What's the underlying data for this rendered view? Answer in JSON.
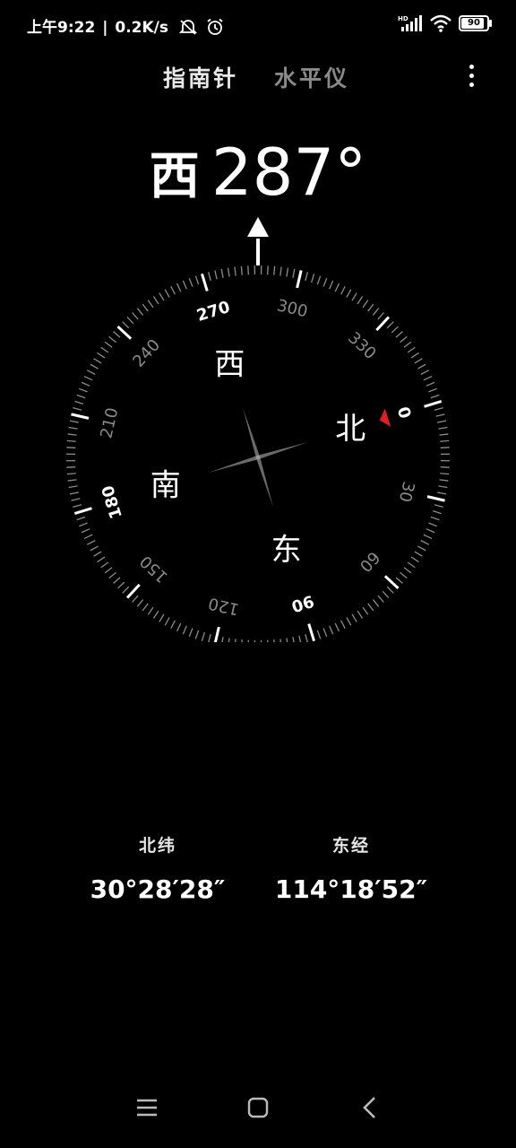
{
  "status_bar": {
    "time": "上午9:22",
    "network_speed": "0.2K/s",
    "muted_icon": "bell-off-icon",
    "alarm_icon": "alarm-icon",
    "hd_label": "HD",
    "battery": "90"
  },
  "tabs": [
    {
      "label": "指南针",
      "active": true
    },
    {
      "label": "水平仪",
      "active": false
    }
  ],
  "heading": {
    "direction": "西",
    "degrees": "287°",
    "value": 287
  },
  "dial": {
    "degree_labels": [
      "0",
      "30",
      "60",
      "90",
      "120",
      "150",
      "180",
      "210",
      "240",
      "270",
      "300",
      "330"
    ],
    "cardinals": {
      "north": "北",
      "east": "东",
      "south": "南",
      "west": "西"
    },
    "north_marker_color": "#e02020"
  },
  "coordinates": {
    "latitude_label": "北纬",
    "latitude_value": "30°28′28″",
    "longitude_label": "东经",
    "longitude_value": "114°18′52″"
  }
}
